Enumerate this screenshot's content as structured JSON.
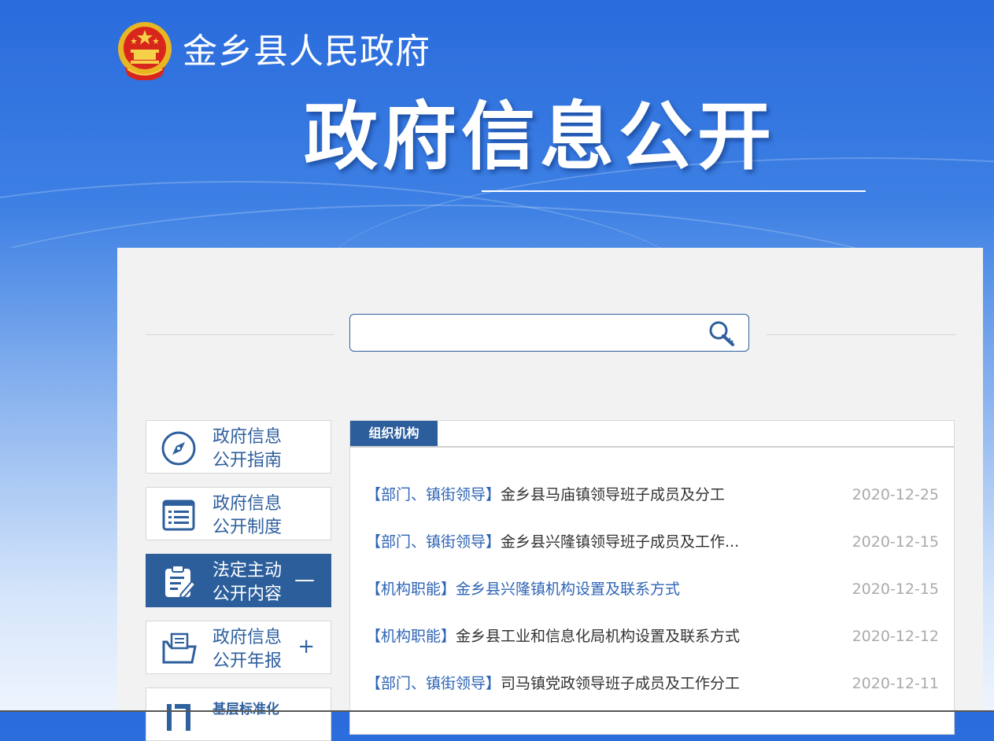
{
  "site": {
    "name": "金乡县人民政府",
    "hero_title": "政府信息公开"
  },
  "search": {
    "placeholder": ""
  },
  "sidebar": {
    "items": [
      {
        "line1": "政府信息",
        "line2": "公开指南",
        "icon": "compass-icon",
        "active": false,
        "toggle": ""
      },
      {
        "line1": "政府信息",
        "line2": "公开制度",
        "icon": "list-icon",
        "active": false,
        "toggle": ""
      },
      {
        "line1": "法定主动",
        "line2": "公开内容",
        "icon": "clipboard-edit-icon",
        "active": true,
        "toggle": "—"
      },
      {
        "line1": "政府信息",
        "line2": "公开年报",
        "icon": "folder-document-icon",
        "active": false,
        "toggle": "+"
      },
      {
        "line1": "基层标准化",
        "line2": "",
        "icon": "standard-icon",
        "active": false,
        "toggle": ""
      }
    ]
  },
  "main": {
    "tab": "组织机构",
    "list": [
      {
        "tag": "【部门、镇街领导】",
        "title": "金乡县马庙镇领导班子成员及分工",
        "date": "2020-12-25"
      },
      {
        "tag": "【部门、镇街领导】",
        "title": "金乡县兴隆镇领导班子成员及工作...",
        "date": "2020-12-15"
      },
      {
        "tag": "【机构职能】",
        "title": "金乡县兴隆镇机构设置及联系方式",
        "date": "2020-12-15"
      },
      {
        "tag": "【机构职能】",
        "title": "金乡县工业和信息化局机构设置及联系方式",
        "date": "2020-12-12"
      },
      {
        "tag": "【部门、镇街领导】",
        "title": "司马镇党政领导班子成员及工作分工",
        "date": "2020-12-11"
      }
    ]
  },
  "colors": {
    "primary": "#2c5e9c",
    "link": "#2e64b5",
    "banner": "#2a6bdc"
  }
}
